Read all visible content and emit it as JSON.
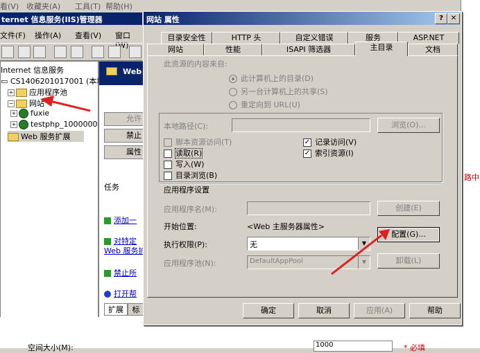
{
  "top_menu": [
    "收藏夹(A)",
    "工具(T)",
    "帮助(H)"
  ],
  "iis_title": "ternet 信息服务(IIS)管理器",
  "iis_menu": [
    "文件(F)",
    "操作(A)",
    "查看(V)",
    "窗口(W)"
  ],
  "tree": {
    "root": "Internet 信息服务",
    "server": "CS1406201017001 (本地计",
    "app_pools": "应用程序池",
    "websites": "网站",
    "site1": "fuxie",
    "site2": "testphp_1000000",
    "web_ext": "Web 服务扩展"
  },
  "right_pane": {
    "web_header": "Web",
    "btn_allow": "允许",
    "btn_deny": "禁止",
    "btn_props": "属性",
    "tasks_title": "任务",
    "task1": "添加一",
    "task2a": "对特定",
    "task2b": "Web 服务扩",
    "task3": "禁止所",
    "task4": "打开帮",
    "tab_ext": "扩展",
    "tab_std": "标"
  },
  "dialog": {
    "title": "网站 属性",
    "help_btn": "?",
    "close_btn": "✕",
    "tabs_row1": [
      "目录安全性",
      "HTTP 头",
      "自定义错误",
      "服务",
      "ASP.NET"
    ],
    "tabs_row2": [
      "网站",
      "性能",
      "ISAPI 筛选器",
      "主目录",
      "文档"
    ],
    "content_source_label": "此资源的内容来自:",
    "radio1": "此计算机上的目录(D)",
    "radio2": "另一台计算机上的共享(S)",
    "radio3": "重定向到 URL(U)",
    "local_path_label": "本地路径(C):",
    "browse_btn": "浏览(O)...",
    "chk_script": "脚本资源访问(T)",
    "chk_read": "读取(R)",
    "chk_write": "写入(W)",
    "chk_browse": "目录浏览(B)",
    "chk_log": "记录访问(V)",
    "chk_index": "索引资源(I)",
    "app_settings": "应用程序设置",
    "app_name_label": "应用程序名(M):",
    "create_btn": "创建(E)",
    "start_point_label": "开始位置:",
    "start_point_value": "<Web 主服务器属性>",
    "config_btn": "配置(G)...",
    "exec_perm_label": "执行权限(P):",
    "exec_perm_value": "无",
    "app_pool_label": "应用程序池(N):",
    "app_pool_value": "DefaultAppPool",
    "unload_btn": "卸载(L)",
    "ok_btn": "确定",
    "cancel_btn": "取消",
    "apply_btn": "应用(A)",
    "help2_btn": "帮助"
  },
  "bottom": {
    "label": "空间大小(M):",
    "value": "1000",
    "req": "* 必填"
  },
  "side_red": "路中",
  "colors": {
    "title": "#0a246a",
    "arrow": "#e02020"
  }
}
